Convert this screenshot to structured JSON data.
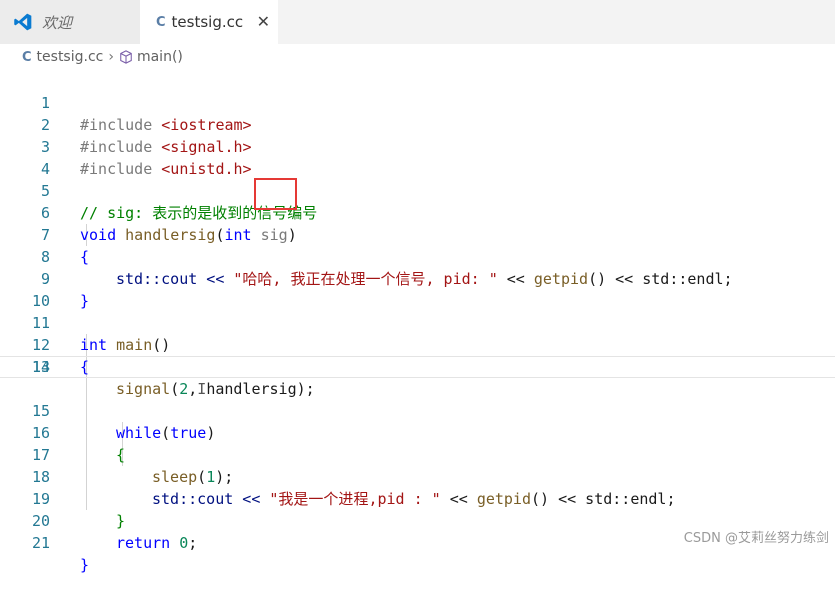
{
  "tabs": [
    {
      "label": "欢迎",
      "icon": "vscode-logo-icon",
      "active": false
    },
    {
      "label": "testsig.cc",
      "icon": "cpp-file-icon",
      "active": true,
      "close": "✕"
    }
  ],
  "breadcrumb": {
    "file": "testsig.cc",
    "symbol": "main()"
  },
  "editor": {
    "line_numbers": [
      "1",
      "2",
      "3",
      "4",
      "5",
      "6",
      "7",
      "8",
      "9",
      "10",
      "11",
      "12",
      "13",
      "14",
      "15",
      "16",
      "17",
      "18",
      "19",
      "20",
      "21"
    ],
    "code": {
      "l1_pp": "#include ",
      "l1_inc": "<iostream>",
      "l2_pp": "#include ",
      "l2_inc": "<signal.h>",
      "l3_pp": "#include ",
      "l3_inc": "<unistd.h>",
      "l5": "// sig: 表示的是收到的信号编号",
      "l6_kw": "void",
      "l6_fn": "handlersig",
      "l6_open": "(",
      "l6_kw2": "int",
      "l6_param": "sig",
      "l6_close": ")",
      "l7": "{",
      "l8_a": "std::cout << ",
      "l8_str": "\"哈哈, 我正在处理一个信号, pid: \"",
      "l8_b": " << ",
      "l8_fn": "getpid",
      "l8_c": "() << std::endl;",
      "l10": "}",
      "l11_kw": "int",
      "l11_fn": "main",
      "l11_rest": "()",
      "l12": "{",
      "l13_fn": "signal",
      "l13_a": "(",
      "l13_num": "2",
      "l13_b": ",",
      "l13_cursor": "I",
      "l13_c": "handlersig);",
      "l15_kw": "while",
      "l15_a": "(",
      "l15_kw2": "true",
      "l15_b": ")",
      "l16": "{",
      "l17_fn": "sleep",
      "l17_a": "(",
      "l17_num": "1",
      "l17_b": ");",
      "l18_a": "std::cout << ",
      "l18_str": "\"我是一个进程,pid : \"",
      "l18_b": " << ",
      "l18_fn": "getpid",
      "l18_c": "() << std::endl;",
      "l19": "}",
      "l20_kw": "return",
      "l20_num": "0",
      "l20_end": ";",
      "l21": "}"
    }
  },
  "watermark": "CSDN @艾莉丝努力练剑",
  "colors": {
    "accent": "#007acc",
    "highlight_box": "#e53935"
  }
}
